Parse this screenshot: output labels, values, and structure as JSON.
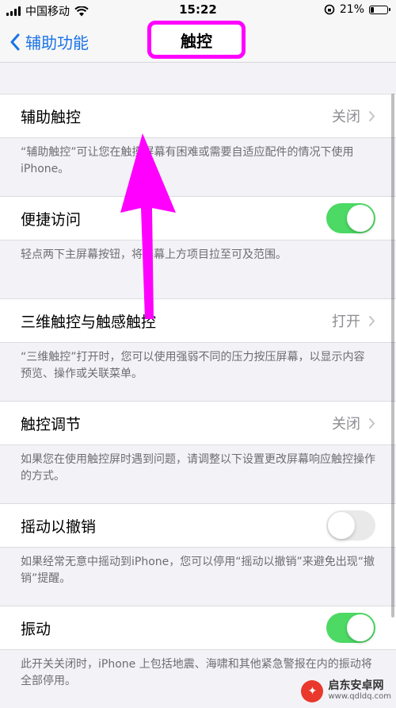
{
  "status": {
    "carrier": "中国移动",
    "time": "15:22",
    "battery": "21%",
    "battery_level": 0.21
  },
  "nav": {
    "back_label": "辅助功能",
    "title": "触控"
  },
  "rows": [
    {
      "label": "辅助触控",
      "value": "关闭",
      "footnote": "“辅助触控”可让您在触摸屏幕有困难或需要自适应配件的情况下使用 iPhone。"
    },
    {
      "label": "便捷访问",
      "toggle": "on",
      "footnote": "轻点两下主屏幕按钮，将屏幕上方项目拉至可及范围。"
    },
    {
      "label": "三维触控与触感触控",
      "value": "打开",
      "footnote": "“三维触控”打开时，您可以使用强弱不同的压力按压屏幕，以显示内容预览、操作或关联菜单。"
    },
    {
      "label": "触控调节",
      "value": "关闭",
      "footnote": "如果您在使用触控屏时遇到问题，请调整以下设置更改屏幕响应触控操作的方式。"
    },
    {
      "label": "摇动以撤销",
      "toggle": "off",
      "footnote": "如果经常无意中摇动到iPhone，您可以停用“摇动以撤销”来避免出现“撤销”提醒。"
    },
    {
      "label": "振动",
      "toggle": "on",
      "footnote": "此开关关闭时，iPhone 上包括地震、海啸和其他紧急警报在内的振动将全部停用。"
    }
  ],
  "watermark": {
    "title": "启东安卓网",
    "url": "www.qdldq.com"
  },
  "colors": {
    "accent": "#1a73e8",
    "toggle_on": "#4cd964",
    "annotation": "#ff00ff"
  },
  "icons": {
    "back": "chevron-left-icon",
    "disclosure": "chevron-right-icon"
  }
}
